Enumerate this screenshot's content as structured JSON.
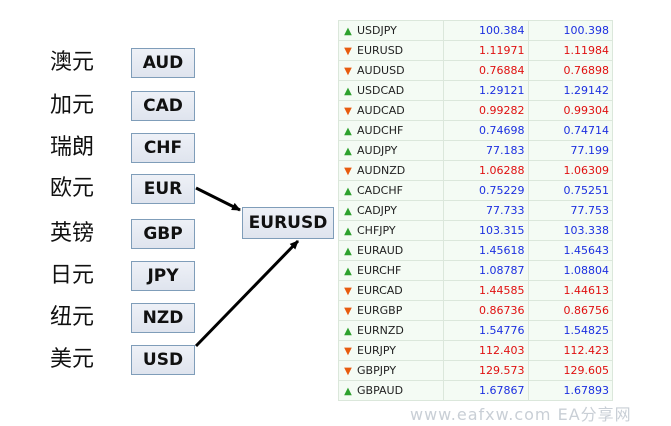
{
  "currencies": [
    {
      "cn": "澳元",
      "code": "AUD"
    },
    {
      "cn": "加元",
      "code": "CAD"
    },
    {
      "cn": "瑞朗",
      "code": "CHF"
    },
    {
      "cn": "欧元",
      "code": "EUR"
    },
    {
      "cn": "英镑",
      "code": "GBP"
    },
    {
      "cn": "日元",
      "code": "JPY"
    },
    {
      "cn": "纽元",
      "code": "NZD"
    },
    {
      "cn": "美元",
      "code": "USD"
    }
  ],
  "pair": "EURUSD",
  "arrow_links": [
    "EUR",
    "USD"
  ],
  "quotes": [
    {
      "symbol": "USDJPY",
      "bid": "100.384",
      "ask": "100.398",
      "dir": "up"
    },
    {
      "symbol": "EURUSD",
      "bid": "1.11971",
      "ask": "1.11984",
      "dir": "down"
    },
    {
      "symbol": "AUDUSD",
      "bid": "0.76884",
      "ask": "0.76898",
      "dir": "down"
    },
    {
      "symbol": "USDCAD",
      "bid": "1.29121",
      "ask": "1.29142",
      "dir": "up"
    },
    {
      "symbol": "AUDCAD",
      "bid": "0.99282",
      "ask": "0.99304",
      "dir": "down"
    },
    {
      "symbol": "AUDCHF",
      "bid": "0.74698",
      "ask": "0.74714",
      "dir": "up"
    },
    {
      "symbol": "AUDJPY",
      "bid": "77.183",
      "ask": "77.199",
      "dir": "up"
    },
    {
      "symbol": "AUDNZD",
      "bid": "1.06288",
      "ask": "1.06309",
      "dir": "down"
    },
    {
      "symbol": "CADCHF",
      "bid": "0.75229",
      "ask": "0.75251",
      "dir": "up"
    },
    {
      "symbol": "CADJPY",
      "bid": "77.733",
      "ask": "77.753",
      "dir": "up"
    },
    {
      "symbol": "CHFJPY",
      "bid": "103.315",
      "ask": "103.338",
      "dir": "up"
    },
    {
      "symbol": "EURAUD",
      "bid": "1.45618",
      "ask": "1.45643",
      "dir": "up"
    },
    {
      "symbol": "EURCHF",
      "bid": "1.08787",
      "ask": "1.08804",
      "dir": "up"
    },
    {
      "symbol": "EURCAD",
      "bid": "1.44585",
      "ask": "1.44613",
      "dir": "down"
    },
    {
      "symbol": "EURGBP",
      "bid": "0.86736",
      "ask": "0.86756",
      "dir": "down"
    },
    {
      "symbol": "EURNZD",
      "bid": "1.54776",
      "ask": "1.54825",
      "dir": "up"
    },
    {
      "symbol": "EURJPY",
      "bid": "112.403",
      "ask": "112.423",
      "dir": "down"
    },
    {
      "symbol": "GBPJPY",
      "bid": "129.573",
      "ask": "129.605",
      "dir": "down"
    },
    {
      "symbol": "GBPAUD",
      "bid": "1.67867",
      "ask": "1.67893",
      "dir": "up"
    }
  ],
  "colors": {
    "up_price": "#1c2fe0",
    "down_price": "#e01010",
    "up_icon": "#2ea12e",
    "down_icon": "#e85a0e",
    "arrow": "#000000"
  },
  "icons": {
    "up": "arrow-up-icon",
    "down": "arrow-down-icon"
  },
  "watermark": "www.eafxw.com EA分享网"
}
